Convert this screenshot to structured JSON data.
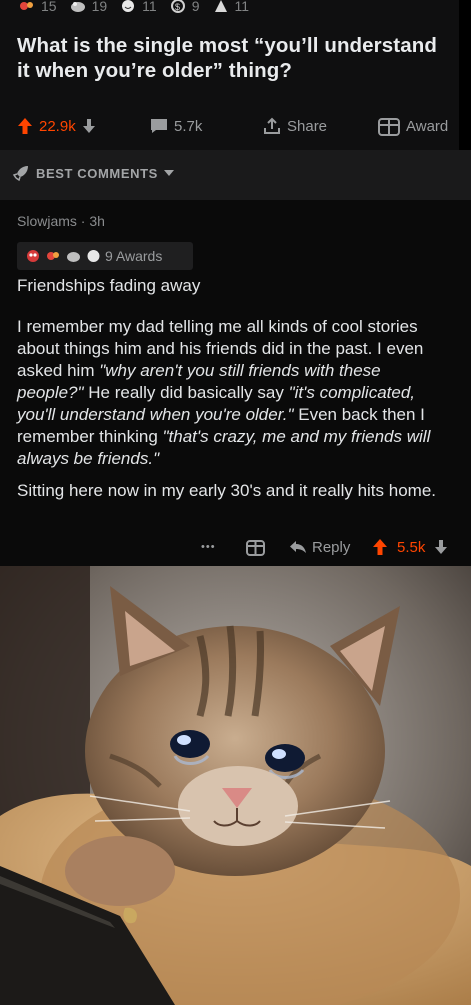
{
  "post": {
    "award_counts": [
      "15",
      "19",
      "11",
      "9",
      "11"
    ],
    "title": "What is the single most “you’ll understand it when you’re older” thing?",
    "upvotes": "22.9k",
    "comments": "5.7k",
    "share_label": "Share",
    "award_label": "Award"
  },
  "sort": {
    "label": "BEST COMMENTS"
  },
  "comment": {
    "author": "Slowjams",
    "age": "3h",
    "awards_label": "9 Awards",
    "heading": "Friendships fading away",
    "para1_a": "I remember my dad telling me all kinds of cool stories about things him and his friends did in the past. I even asked him ",
    "para1_q1": "\"why aren't you still friends with these people?\"",
    "para1_b": " He really did basically say ",
    "para1_q2": "\"it's complicated, you'll understand when you're older.\"",
    "para1_c": " Even back then I remember thinking ",
    "para1_q3": "\"that's crazy, me and my friends will always be friends.\"",
    "para2": "Sitting here now in my early 30's and it really hits home.",
    "more": "•••",
    "reply_label": "Reply",
    "upvotes": "5.5k"
  },
  "colors": {
    "upvote": "#ff4500",
    "background": "#000000",
    "card": "#0f0f10",
    "sortbar": "#1a1a1b"
  },
  "image": {
    "subject": "crying-cat-holding-phone"
  }
}
